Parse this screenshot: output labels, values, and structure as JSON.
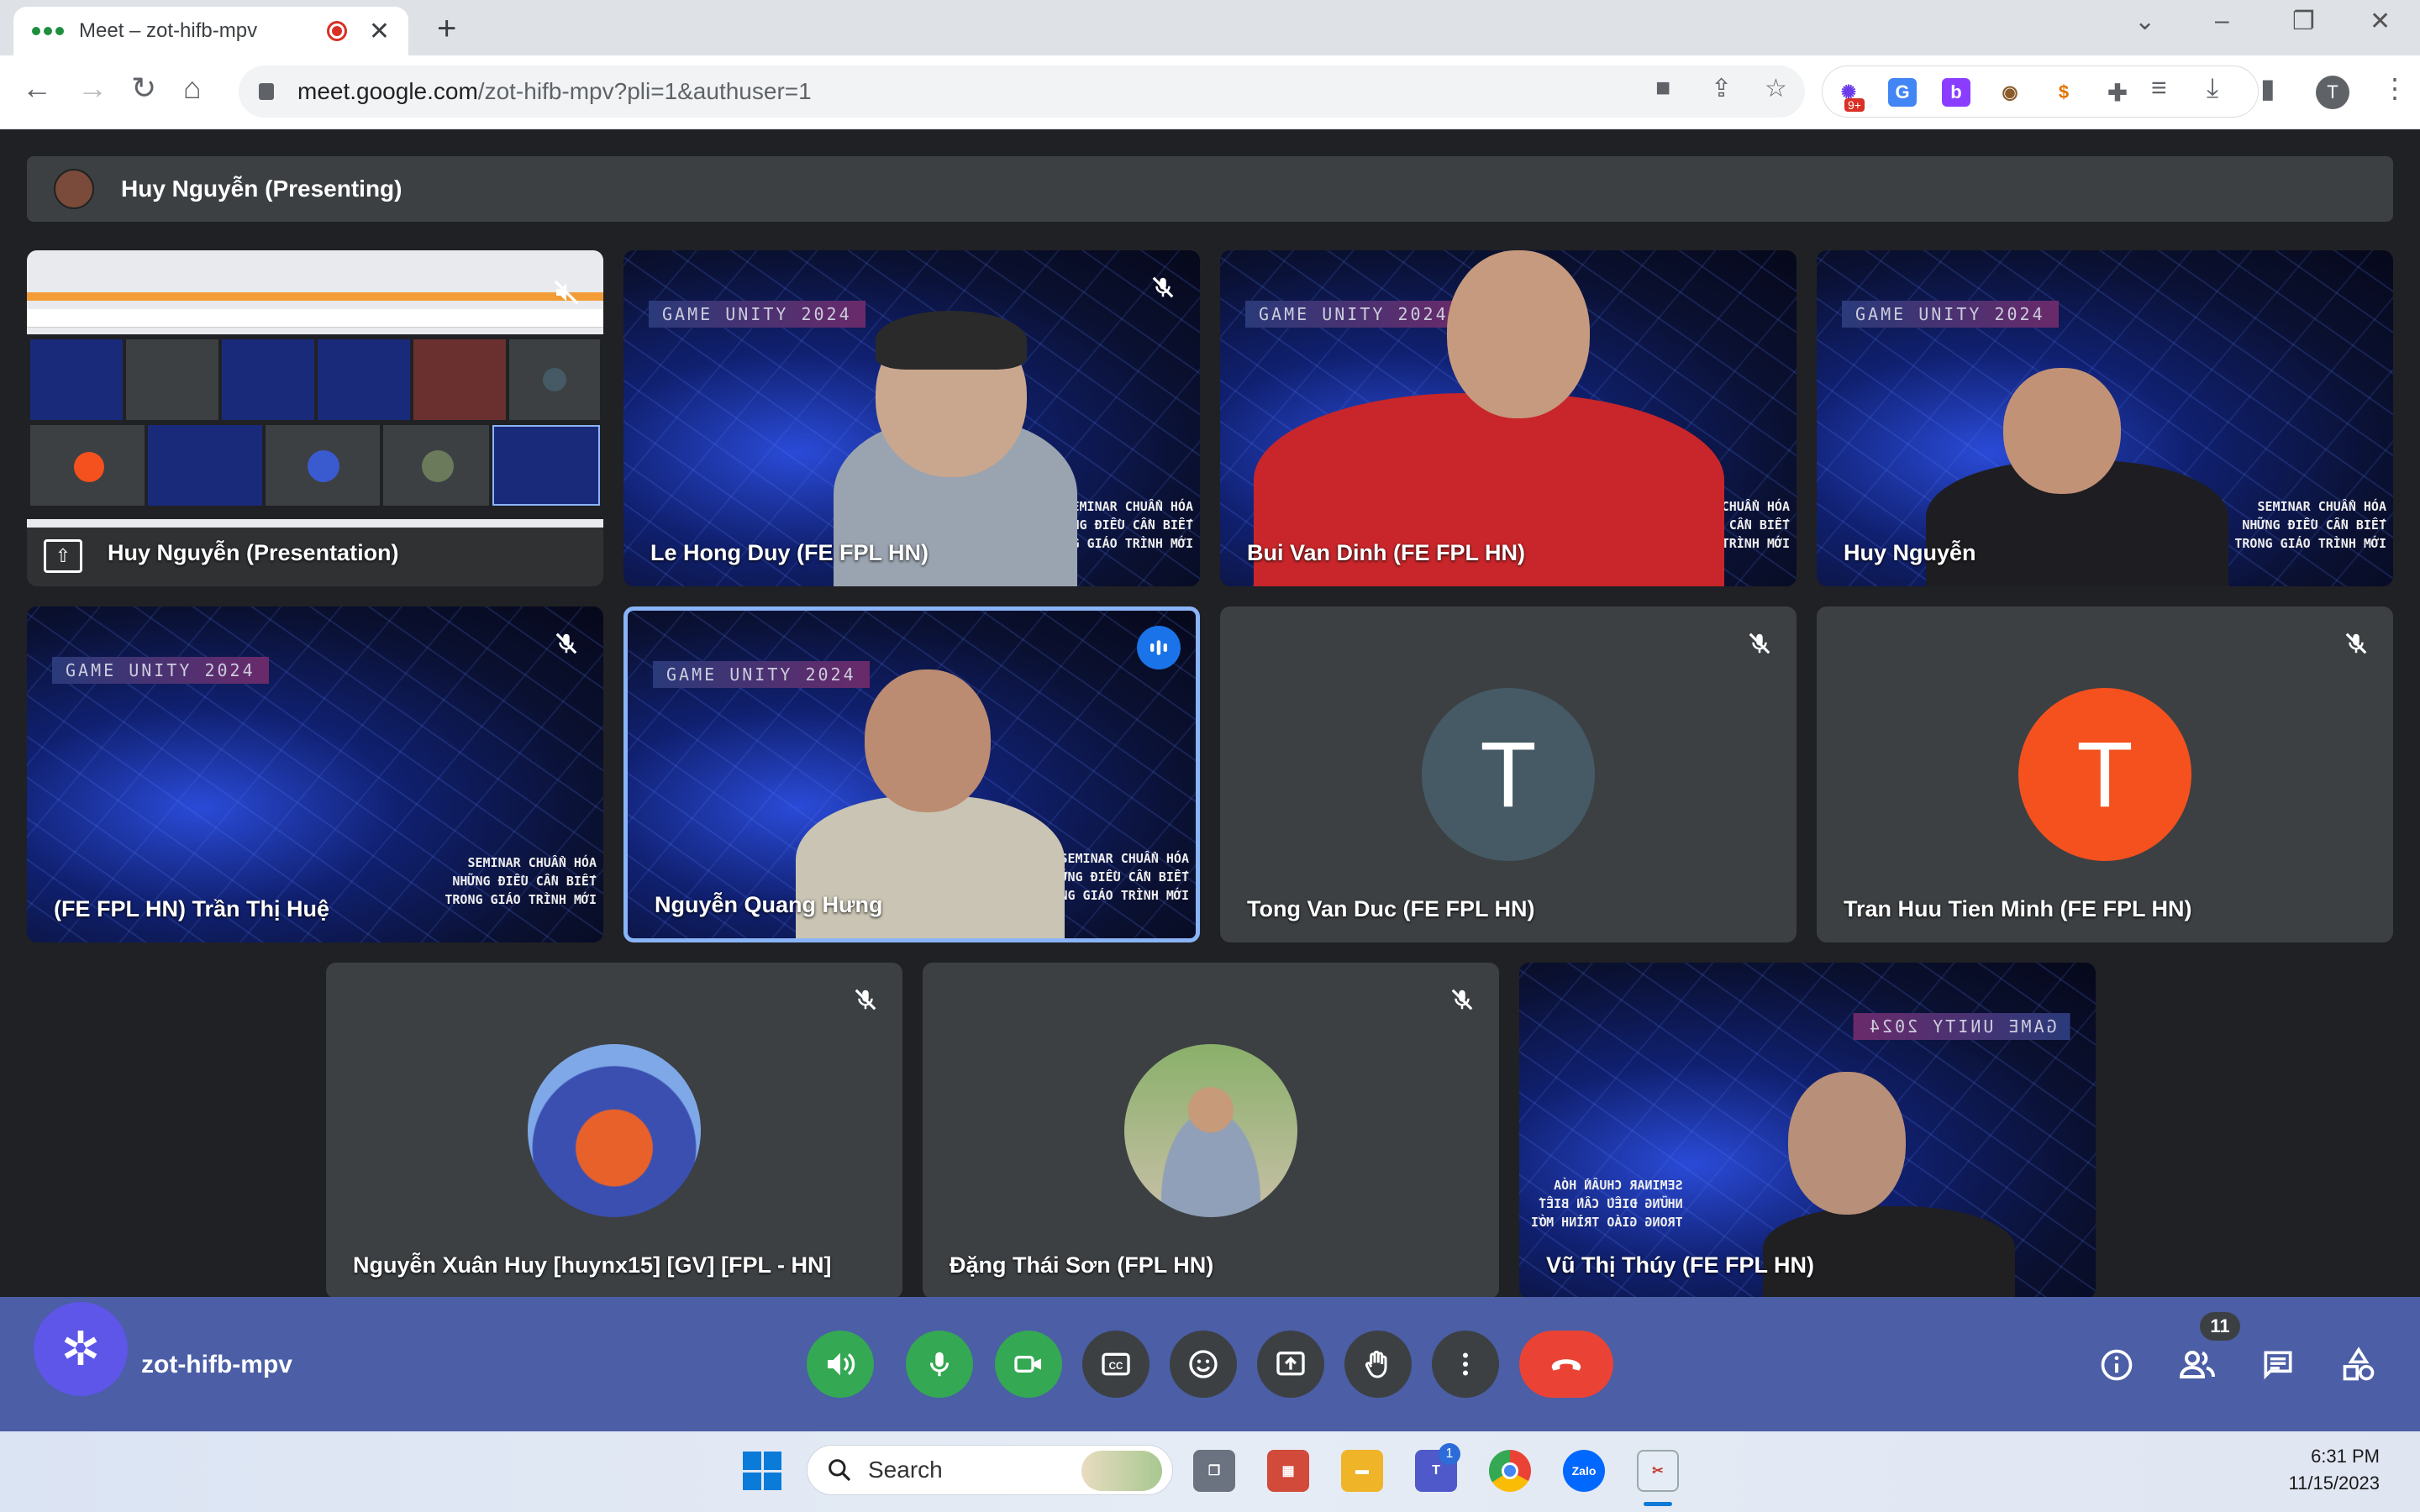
{
  "browser": {
    "tab_title": "Meet – zot-hifb-mpv",
    "url_host": "meet.google.com",
    "url_path": "/zot-hifb-mpv?pli=1&authuser=1",
    "profile_initial": "T",
    "ext_badge": "9+"
  },
  "meet": {
    "presenting_banner": "Huy Nguyễn (Presenting)",
    "tiles": [
      {
        "name": "Huy Nguyễn (Presentation)"
      },
      {
        "name": "Le Hong Duy (FE FPL HN)"
      },
      {
        "name": "Bui Van Dinh (FE FPL HN)"
      },
      {
        "name": "Huy Nguyễn"
      },
      {
        "name": "(FE FPL HN) Trần Thị Huệ"
      },
      {
        "name": "Nguyễn Quang Hưng"
      },
      {
        "name": "Tong Van Duc (FE FPL HN)",
        "initial": "T",
        "avatar_color": "#455a64"
      },
      {
        "name": "Tran Huu Tien Minh (FE FPL HN)",
        "initial": "T",
        "avatar_color": "#f4511e"
      },
      {
        "name": "Nguyễn Xuân Huy [huynx15] [GV] [FPL - HN]"
      },
      {
        "name": "Đặng Thái Sơn (FPL HN)"
      },
      {
        "name": "Vũ Thị Thúy (FE FPL HN)"
      }
    ],
    "background_banner": "GAME UNITY 2024",
    "background_banner_mirrored": "GAME UNITY 2024",
    "seminar_text": [
      "SEMINAR CHUẨN HÓA",
      "NHỮNG ĐIỀU CẦN BIẾT",
      "TRONG GIÁO TRÌNH MỚI"
    ],
    "meeting_code": "zot-hifb-mpv",
    "participant_count": "11"
  },
  "taskbar": {
    "search_label": "Search",
    "teams_badge": "1",
    "time": "6:31 PM",
    "date": "11/15/2023"
  },
  "colors": {
    "accent_green": "#34a853",
    "end_call_red": "#ea4335",
    "control_bar": "#4b5ea6",
    "speaking_border": "#8ab4f8"
  }
}
